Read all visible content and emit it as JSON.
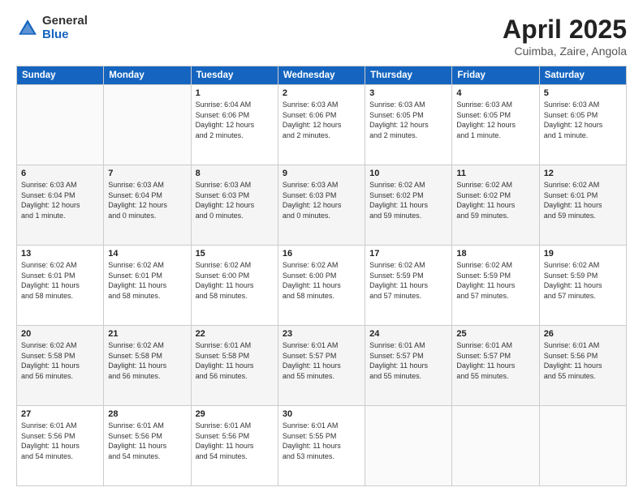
{
  "header": {
    "logo_general": "General",
    "logo_blue": "Blue",
    "title": "April 2025",
    "location": "Cuimba, Zaire, Angola"
  },
  "weekdays": [
    "Sunday",
    "Monday",
    "Tuesday",
    "Wednesday",
    "Thursday",
    "Friday",
    "Saturday"
  ],
  "weeks": [
    [
      {
        "day": "",
        "info": ""
      },
      {
        "day": "",
        "info": ""
      },
      {
        "day": "1",
        "info": "Sunrise: 6:04 AM\nSunset: 6:06 PM\nDaylight: 12 hours\nand 2 minutes."
      },
      {
        "day": "2",
        "info": "Sunrise: 6:03 AM\nSunset: 6:06 PM\nDaylight: 12 hours\nand 2 minutes."
      },
      {
        "day": "3",
        "info": "Sunrise: 6:03 AM\nSunset: 6:05 PM\nDaylight: 12 hours\nand 2 minutes."
      },
      {
        "day": "4",
        "info": "Sunrise: 6:03 AM\nSunset: 6:05 PM\nDaylight: 12 hours\nand 1 minute."
      },
      {
        "day": "5",
        "info": "Sunrise: 6:03 AM\nSunset: 6:05 PM\nDaylight: 12 hours\nand 1 minute."
      }
    ],
    [
      {
        "day": "6",
        "info": "Sunrise: 6:03 AM\nSunset: 6:04 PM\nDaylight: 12 hours\nand 1 minute."
      },
      {
        "day": "7",
        "info": "Sunrise: 6:03 AM\nSunset: 6:04 PM\nDaylight: 12 hours\nand 0 minutes."
      },
      {
        "day": "8",
        "info": "Sunrise: 6:03 AM\nSunset: 6:03 PM\nDaylight: 12 hours\nand 0 minutes."
      },
      {
        "day": "9",
        "info": "Sunrise: 6:03 AM\nSunset: 6:03 PM\nDaylight: 12 hours\nand 0 minutes."
      },
      {
        "day": "10",
        "info": "Sunrise: 6:02 AM\nSunset: 6:02 PM\nDaylight: 11 hours\nand 59 minutes."
      },
      {
        "day": "11",
        "info": "Sunrise: 6:02 AM\nSunset: 6:02 PM\nDaylight: 11 hours\nand 59 minutes."
      },
      {
        "day": "12",
        "info": "Sunrise: 6:02 AM\nSunset: 6:01 PM\nDaylight: 11 hours\nand 59 minutes."
      }
    ],
    [
      {
        "day": "13",
        "info": "Sunrise: 6:02 AM\nSunset: 6:01 PM\nDaylight: 11 hours\nand 58 minutes."
      },
      {
        "day": "14",
        "info": "Sunrise: 6:02 AM\nSunset: 6:01 PM\nDaylight: 11 hours\nand 58 minutes."
      },
      {
        "day": "15",
        "info": "Sunrise: 6:02 AM\nSunset: 6:00 PM\nDaylight: 11 hours\nand 58 minutes."
      },
      {
        "day": "16",
        "info": "Sunrise: 6:02 AM\nSunset: 6:00 PM\nDaylight: 11 hours\nand 58 minutes."
      },
      {
        "day": "17",
        "info": "Sunrise: 6:02 AM\nSunset: 5:59 PM\nDaylight: 11 hours\nand 57 minutes."
      },
      {
        "day": "18",
        "info": "Sunrise: 6:02 AM\nSunset: 5:59 PM\nDaylight: 11 hours\nand 57 minutes."
      },
      {
        "day": "19",
        "info": "Sunrise: 6:02 AM\nSunset: 5:59 PM\nDaylight: 11 hours\nand 57 minutes."
      }
    ],
    [
      {
        "day": "20",
        "info": "Sunrise: 6:02 AM\nSunset: 5:58 PM\nDaylight: 11 hours\nand 56 minutes."
      },
      {
        "day": "21",
        "info": "Sunrise: 6:02 AM\nSunset: 5:58 PM\nDaylight: 11 hours\nand 56 minutes."
      },
      {
        "day": "22",
        "info": "Sunrise: 6:01 AM\nSunset: 5:58 PM\nDaylight: 11 hours\nand 56 minutes."
      },
      {
        "day": "23",
        "info": "Sunrise: 6:01 AM\nSunset: 5:57 PM\nDaylight: 11 hours\nand 55 minutes."
      },
      {
        "day": "24",
        "info": "Sunrise: 6:01 AM\nSunset: 5:57 PM\nDaylight: 11 hours\nand 55 minutes."
      },
      {
        "day": "25",
        "info": "Sunrise: 6:01 AM\nSunset: 5:57 PM\nDaylight: 11 hours\nand 55 minutes."
      },
      {
        "day": "26",
        "info": "Sunrise: 6:01 AM\nSunset: 5:56 PM\nDaylight: 11 hours\nand 55 minutes."
      }
    ],
    [
      {
        "day": "27",
        "info": "Sunrise: 6:01 AM\nSunset: 5:56 PM\nDaylight: 11 hours\nand 54 minutes."
      },
      {
        "day": "28",
        "info": "Sunrise: 6:01 AM\nSunset: 5:56 PM\nDaylight: 11 hours\nand 54 minutes."
      },
      {
        "day": "29",
        "info": "Sunrise: 6:01 AM\nSunset: 5:56 PM\nDaylight: 11 hours\nand 54 minutes."
      },
      {
        "day": "30",
        "info": "Sunrise: 6:01 AM\nSunset: 5:55 PM\nDaylight: 11 hours\nand 53 minutes."
      },
      {
        "day": "",
        "info": ""
      },
      {
        "day": "",
        "info": ""
      },
      {
        "day": "",
        "info": ""
      }
    ]
  ]
}
